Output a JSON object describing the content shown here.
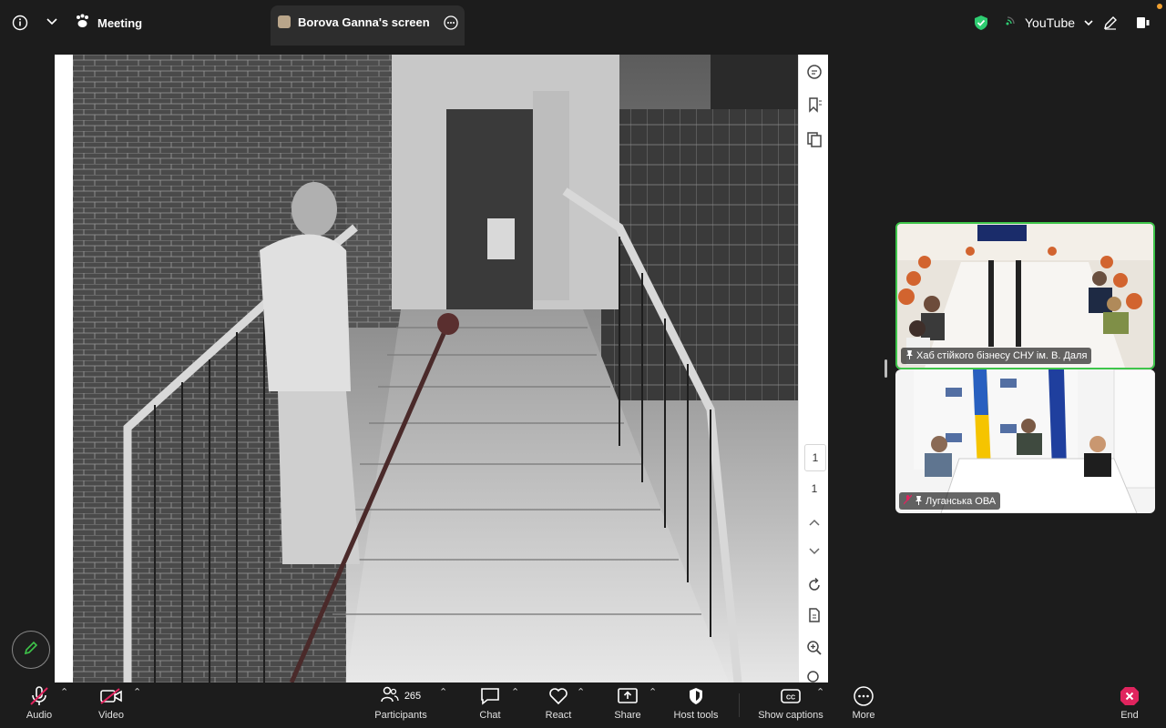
{
  "header": {
    "meeting_label": "Meeting",
    "tab_label": "Borova Ganna's screen",
    "youtube_label": "YouTube"
  },
  "icons": {
    "info": "info-icon",
    "chevron": "chevron-down-icon",
    "meeting": "paw-icon",
    "tab_more": "ellipsis-icon",
    "shield": "shield-check-icon",
    "signal": "signal-icon",
    "pencil": "pencil-icon",
    "exit": "sidebar-toggle-icon"
  },
  "shared_screen": {
    "page_numbers": [
      "1",
      "1"
    ]
  },
  "video_tiles": [
    {
      "label": "Хаб стійкого бізнесу СНУ ім. В. Даля",
      "active_speaker": true
    },
    {
      "label": "Луганська ОВА",
      "active_speaker": false,
      "muted": true
    }
  ],
  "toolbar": {
    "audio": "Audio",
    "video": "Video",
    "participants": "Participants",
    "participants_count": "265",
    "chat": "Chat",
    "react": "React",
    "share": "Share",
    "host_tools": "Host tools",
    "captions": "Show captions",
    "more": "More",
    "end": "End"
  },
  "colors": {
    "background": "#1c1c1c",
    "active_speaker_border": "#3ec54a",
    "end_red": "#e0245e",
    "shield_green": "#2ecc71",
    "mute_red": "#e0245e"
  }
}
